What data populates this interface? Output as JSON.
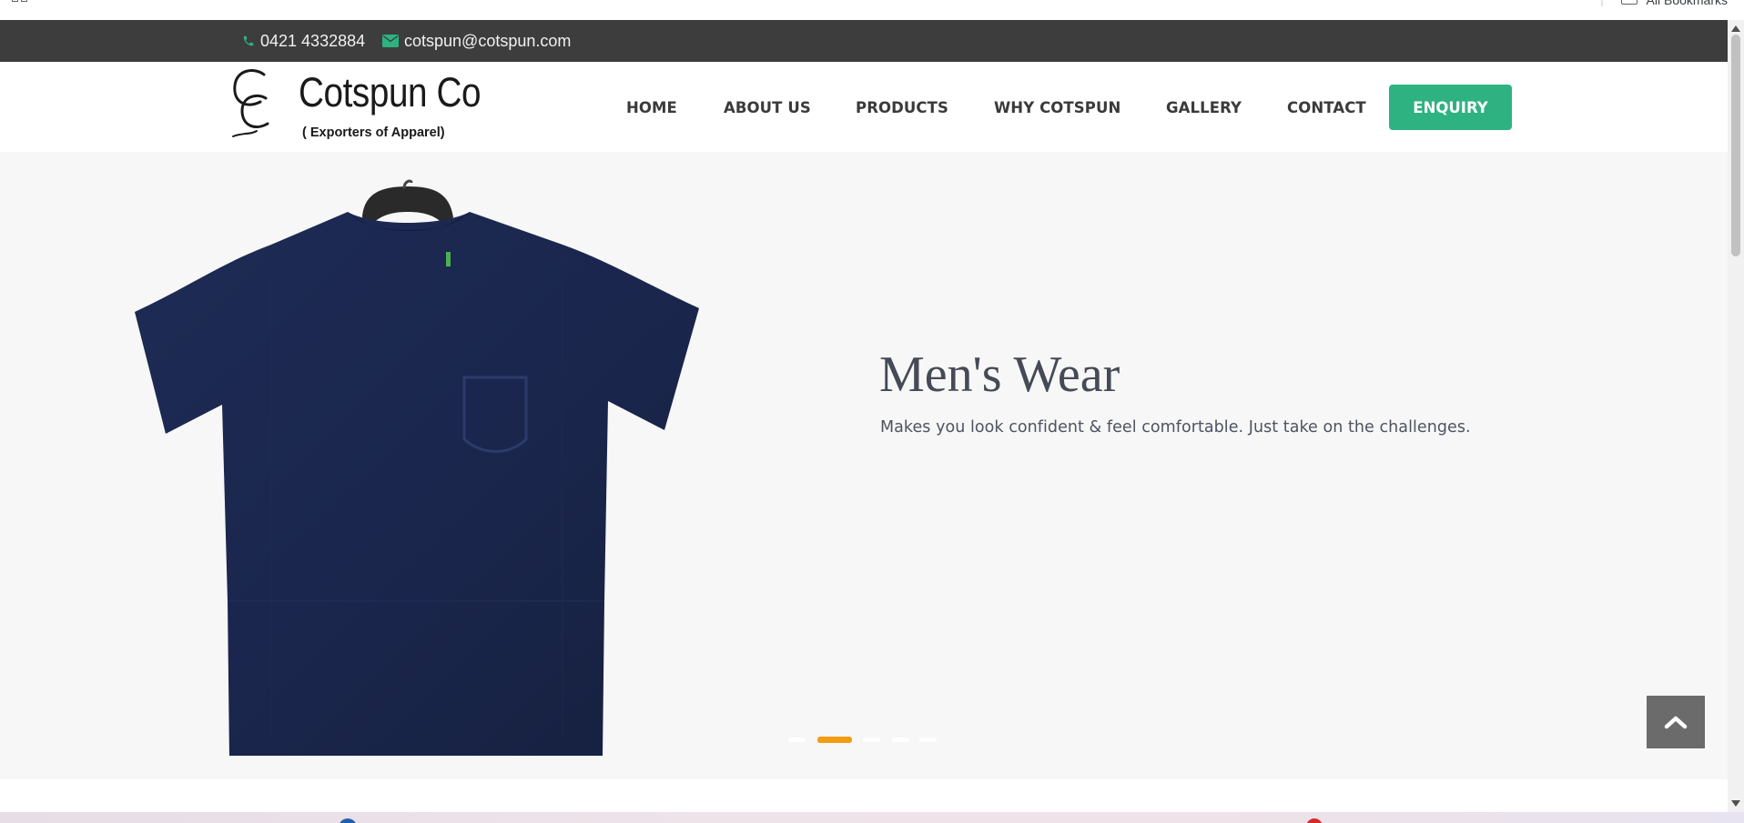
{
  "browser": {
    "bookmarks_label": "All Bookmarks"
  },
  "topbar": {
    "phone": "0421 4332884",
    "email": "cotspun@cotspun.com",
    "icons": {
      "phone": "phone-icon",
      "email": "envelope-icon"
    },
    "icon_color": "#2eb282"
  },
  "logo": {
    "name": "Cotspun Co",
    "tagline": "( Exporters of Apparel)"
  },
  "nav": {
    "items": [
      {
        "label": "HOME"
      },
      {
        "label": "ABOUT US"
      },
      {
        "label": "PRODUCTS"
      },
      {
        "label": "WHY COTSPUN"
      },
      {
        "label": "GALLERY"
      },
      {
        "label": "CONTACT"
      }
    ],
    "cta_label": "ENQUIRY",
    "cta_color": "#2eb282"
  },
  "hero": {
    "title": "Men's Wear",
    "subtitle": "Makes you look confident & feel comfortable. Just take on the challenges.",
    "image": "navy-tshirt-on-hanger",
    "slides_count": 5,
    "active_slide": 2,
    "active_dot_color": "#f39c12"
  },
  "scroll_top": {
    "icon": "chevron-up-icon"
  }
}
